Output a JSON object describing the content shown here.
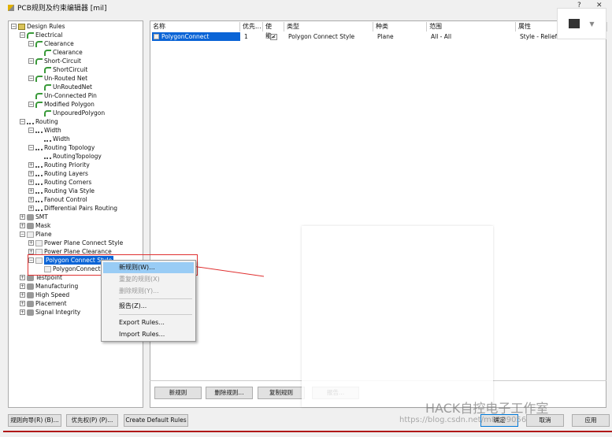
{
  "window": {
    "title": "PCB规则及约束编辑器 [mil]",
    "help": "?",
    "close": "✕"
  },
  "tree": [
    {
      "label": "Design Rules",
      "level": 0,
      "icon": "folder-icon",
      "exp": "−"
    },
    {
      "label": "Electrical",
      "level": 1,
      "icon": "electrical-icon",
      "exp": "−"
    },
    {
      "label": "Clearance",
      "level": 2,
      "icon": "electrical-icon",
      "exp": "−"
    },
    {
      "label": "Clearance",
      "level": 3,
      "icon": "electrical-icon"
    },
    {
      "label": "Short-Circuit",
      "level": 2,
      "icon": "electrical-icon",
      "exp": "−"
    },
    {
      "label": "ShortCircuit",
      "level": 3,
      "icon": "electrical-icon"
    },
    {
      "label": "Un-Routed Net",
      "level": 2,
      "icon": "electrical-icon",
      "exp": "−"
    },
    {
      "label": "UnRoutedNet",
      "level": 3,
      "icon": "electrical-icon"
    },
    {
      "label": "Un-Connected Pin",
      "level": 2,
      "icon": "electrical-icon"
    },
    {
      "label": "Modified Polygon",
      "level": 2,
      "icon": "electrical-icon",
      "exp": "−"
    },
    {
      "label": "UnpouredPolygon",
      "level": 3,
      "icon": "electrical-icon"
    },
    {
      "label": "Routing",
      "level": 1,
      "icon": "routing-icon",
      "exp": "−"
    },
    {
      "label": "Width",
      "level": 2,
      "icon": "routing-icon",
      "exp": "−"
    },
    {
      "label": "Width",
      "level": 3,
      "icon": "routing-icon"
    },
    {
      "label": "Routing Topology",
      "level": 2,
      "icon": "routing-icon",
      "exp": "−"
    },
    {
      "label": "RoutingTopology",
      "level": 3,
      "icon": "routing-icon"
    },
    {
      "label": "Routing Priority",
      "level": 2,
      "icon": "routing-icon",
      "exp": "+"
    },
    {
      "label": "Routing Layers",
      "level": 2,
      "icon": "routing-icon",
      "exp": "+"
    },
    {
      "label": "Routing Corners",
      "level": 2,
      "icon": "routing-icon",
      "exp": "+"
    },
    {
      "label": "Routing Via Style",
      "level": 2,
      "icon": "routing-icon",
      "exp": "+"
    },
    {
      "label": "Fanout Control",
      "level": 2,
      "icon": "routing-icon",
      "exp": "+"
    },
    {
      "label": "Differential Pairs Routing",
      "level": 2,
      "icon": "routing-icon",
      "exp": "+"
    },
    {
      "label": "SMT",
      "level": 1,
      "icon": "smt-icon",
      "exp": "+"
    },
    {
      "label": "Mask",
      "level": 1,
      "icon": "mask-icon",
      "exp": "+"
    },
    {
      "label": "Plane",
      "level": 1,
      "icon": "plane-icon",
      "exp": "−"
    },
    {
      "label": "Power Plane Connect Style",
      "level": 2,
      "icon": "plane-icon",
      "exp": "+"
    },
    {
      "label": "Power Plane Clearance",
      "level": 2,
      "icon": "plane-icon",
      "exp": "+"
    },
    {
      "label": "Polygon Connect Style",
      "level": 2,
      "icon": "plane-icon",
      "exp": "−",
      "selected": true
    },
    {
      "label": "PolygonConnect",
      "level": 3,
      "icon": "plane-icon"
    },
    {
      "label": "Testpoint",
      "level": 1,
      "icon": "testpoint-icon",
      "exp": "+"
    },
    {
      "label": "Manufacturing",
      "level": 1,
      "icon": "manufacturing-icon",
      "exp": "+"
    },
    {
      "label": "High Speed",
      "level": 1,
      "icon": "high-speed-icon",
      "exp": "+"
    },
    {
      "label": "Placement",
      "level": 1,
      "icon": "placement-icon",
      "exp": "+"
    },
    {
      "label": "Signal Integrity",
      "level": 1,
      "icon": "signal-integrity-icon",
      "exp": "+"
    }
  ],
  "table": {
    "columns": [
      "名称",
      "优先...",
      "使能...",
      "类型",
      "种类",
      "范围",
      "属性"
    ],
    "rows": [
      {
        "name": "PolygonConnect",
        "priority": "1",
        "enabled": true,
        "type": "Polygon Connect Style",
        "kind": "Plane",
        "scope": "All   -   All",
        "attrs": "Style - Relief Connect   Width -"
      }
    ]
  },
  "main_buttons": [
    "新规则",
    "删除规则...",
    "复制规则",
    "报告..."
  ],
  "context_menu": [
    {
      "label": "新规则(W)...",
      "state": "highlighted"
    },
    {
      "label": "重复的规则(X)",
      "state": "disabled"
    },
    {
      "label": "删除规则(Y)...",
      "state": "disabled"
    },
    {
      "label": "报告(Z)...",
      "state": "normal"
    },
    {
      "label": "Export Rules...",
      "state": "normal"
    },
    {
      "label": "Import Rules...",
      "state": "normal"
    }
  ],
  "bottom_buttons": [
    "规则向导(R) (B)...",
    "优先权(P) (P)...",
    "Create Default Rules"
  ],
  "dialog_buttons": [
    "确定",
    "取消",
    "应用"
  ],
  "watermark": "HACK自控电子工作室",
  "watermark_url": "https://blog.csdn.net/m8199056",
  "colors": {
    "selection": "#0a64d6",
    "menu_highlight": "#99ccf5",
    "annotation": "#e03030"
  }
}
